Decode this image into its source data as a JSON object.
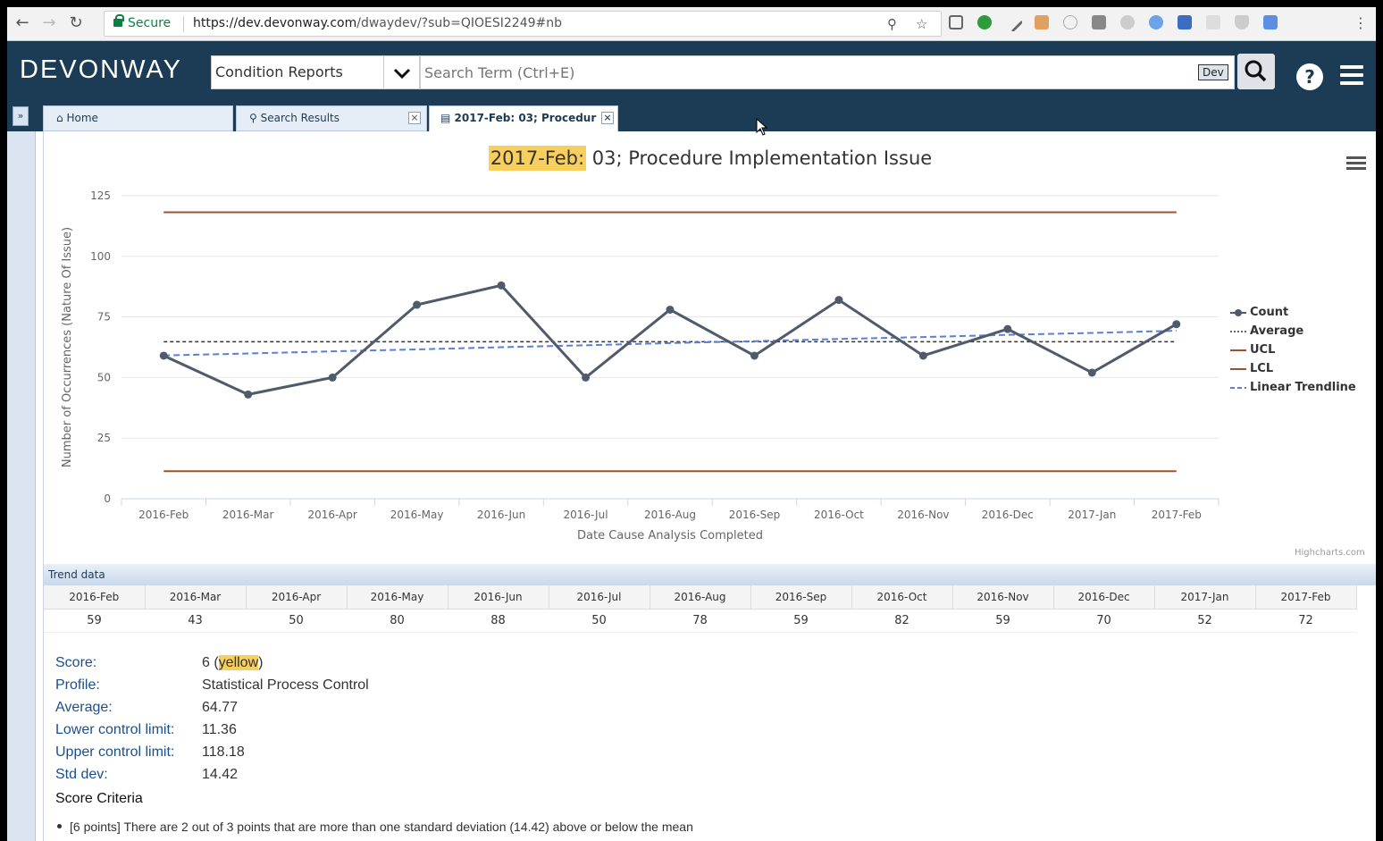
{
  "browser": {
    "secure_label": "Secure",
    "url_host": "https://dev.devonway.com",
    "url_path": "/dwaydev/?sub=QIOESI2249#nb"
  },
  "app": {
    "logo": "DEVONWAY",
    "category": "Condition Reports",
    "search_placeholder": "Search Term (Ctrl+E)",
    "env_badge": "Dev",
    "help_label": "?"
  },
  "tabs": [
    {
      "label": "Home",
      "icon": "home-icon"
    },
    {
      "label": "Search Results",
      "icon": "search-icon"
    },
    {
      "label": "2017-Feb: 03; Procedur",
      "icon": "chart-icon"
    }
  ],
  "chart": {
    "title_highlight": "2017-Feb:",
    "title_rest": "03; Procedure Implementation Issue",
    "credits": "Highcharts.com"
  },
  "chart_data": {
    "type": "line",
    "title": "2017-Feb: 03; Procedure Implementation Issue",
    "xlabel": "Date Cause Analysis Completed",
    "ylabel": "Number of Occurrences (Nature Of Issue)",
    "ylim": [
      0,
      125
    ],
    "yticks": [
      0,
      25,
      50,
      75,
      100,
      125
    ],
    "categories": [
      "2016-Feb",
      "2016-Mar",
      "2016-Apr",
      "2016-May",
      "2016-Jun",
      "2016-Jul",
      "2016-Aug",
      "2016-Sep",
      "2016-Oct",
      "2016-Nov",
      "2016-Dec",
      "2017-Jan",
      "2017-Feb"
    ],
    "series": [
      {
        "name": "Count",
        "values": [
          59,
          43,
          50,
          80,
          88,
          50,
          78,
          59,
          82,
          59,
          70,
          52,
          72
        ],
        "color": "#4f5b6b"
      },
      {
        "name": "Average",
        "values": [
          64.77,
          64.77,
          64.77,
          64.77,
          64.77,
          64.77,
          64.77,
          64.77,
          64.77,
          64.77,
          64.77,
          64.77,
          64.77
        ],
        "color": "#333333"
      },
      {
        "name": "UCL",
        "values": [
          118.18,
          118.18,
          118.18,
          118.18,
          118.18,
          118.18,
          118.18,
          118.18,
          118.18,
          118.18,
          118.18,
          118.18,
          118.18
        ],
        "color": "#a0522d"
      },
      {
        "name": "LCL",
        "values": [
          11.36,
          11.36,
          11.36,
          11.36,
          11.36,
          11.36,
          11.36,
          11.36,
          11.36,
          11.36,
          11.36,
          11.36,
          11.36
        ],
        "color": "#a0522d"
      },
      {
        "name": "Linear Trendline",
        "values": [
          59.1,
          59.9,
          60.8,
          61.6,
          62.5,
          63.3,
          64.2,
          65.0,
          65.9,
          66.7,
          67.6,
          68.4,
          69.3
        ],
        "color": "#5b7fd6"
      }
    ],
    "legend": "right",
    "grid": true
  },
  "trend": {
    "header": "Trend data",
    "columns": [
      "2016-Feb",
      "2016-Mar",
      "2016-Apr",
      "2016-May",
      "2016-Jun",
      "2016-Jul",
      "2016-Aug",
      "2016-Sep",
      "2016-Oct",
      "2016-Nov",
      "2016-Dec",
      "2017-Jan",
      "2017-Feb"
    ],
    "values": [
      "59",
      "43",
      "50",
      "80",
      "88",
      "50",
      "78",
      "59",
      "82",
      "59",
      "70",
      "52",
      "72"
    ]
  },
  "stats": {
    "score_label": "Score:",
    "score_value": "6 (",
    "score_color": "yellow",
    "score_close": ")",
    "profile_label": "Profile:",
    "profile_value": "Statistical Process Control",
    "average_label": "Average:",
    "average_value": "64.77",
    "lcl_label": "Lower control limit:",
    "lcl_value": "11.36",
    "ucl_label": "Upper control limit:",
    "ucl_value": "118.18",
    "std_label": "Std dev:",
    "std_value": "14.42"
  },
  "criteria": {
    "title": "Score Criteria",
    "items": [
      "[6 points] There are 2 out of 3 points that are more than one standard deviation (14.42) above or below the mean"
    ]
  }
}
